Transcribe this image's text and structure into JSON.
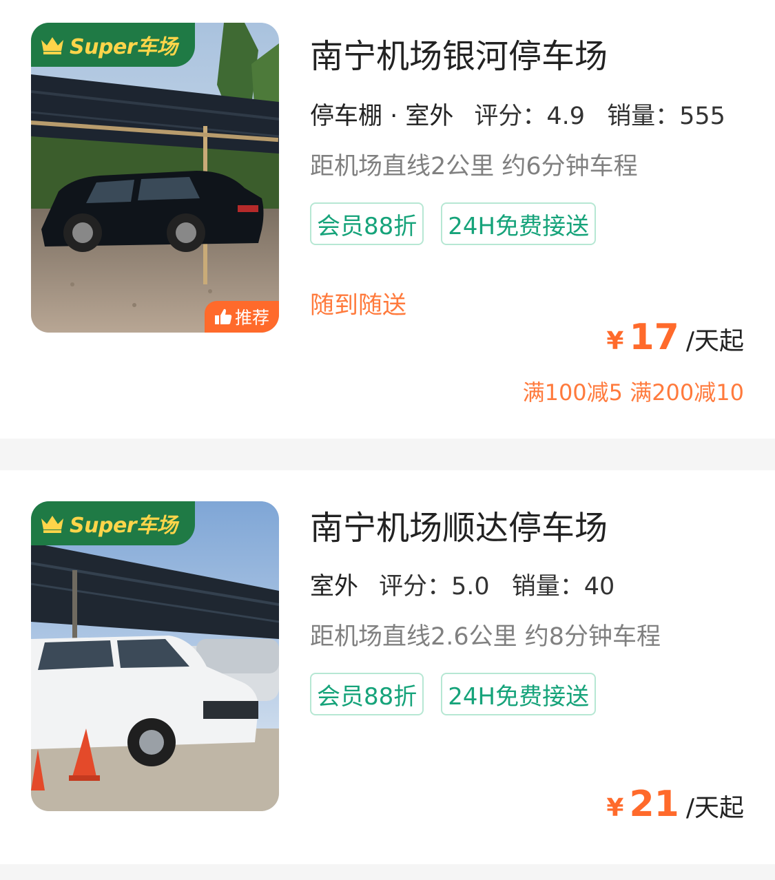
{
  "lots": [
    {
      "badge": "Super车场",
      "recommend": "推荐",
      "name": "南宁机场银河停车场",
      "type": "停车棚 · 室外",
      "rating": "评分：4.9",
      "sales": "销量：555",
      "distance": "距机场直线2公里 约6分钟车程",
      "tags": [
        "会员88折",
        "24H免费接送"
      ],
      "service": "随到随送",
      "currency": "¥",
      "price": "17",
      "unit": "/天起",
      "discount": "满100减5 满200减10",
      "photo_icon": "car-under-shade-photo"
    },
    {
      "badge": "Super车场",
      "name": "南宁机场顺达停车场",
      "type": "室外",
      "rating": "评分：5.0",
      "sales": "销量：40",
      "distance": "距机场直线2.6公里 约8分钟车程",
      "tags": [
        "会员88折",
        "24H免费接送"
      ],
      "currency": "¥",
      "price": "21",
      "unit": "/天起",
      "photo_icon": "white-suv-parking-photo"
    }
  ],
  "colors": {
    "accent_green": "#1f7a45",
    "tag_green": "#16a37a",
    "price_orange": "#ff6a2b",
    "badge_gold": "#ffd54a"
  }
}
